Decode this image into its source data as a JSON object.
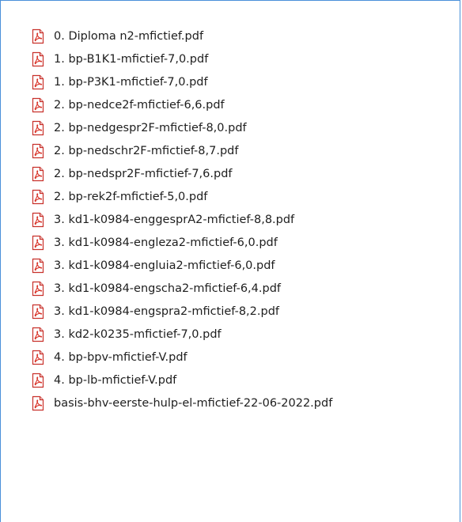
{
  "colors": {
    "border_accent": "#4a90d9",
    "pdf_icon_red": "#d93025",
    "text": "#1e1e1e"
  },
  "file_icon": "pdf-file-icon",
  "files": [
    {
      "name": "0. Diploma n2-mfictief.pdf"
    },
    {
      "name": "1. bp-B1K1-mfictief-7,0.pdf"
    },
    {
      "name": "1. bp-P3K1-mfictief-7,0.pdf"
    },
    {
      "name": "2. bp-nedce2f-mfictief-6,6.pdf"
    },
    {
      "name": "2. bp-nedgespr2F-mfictief-8,0.pdf"
    },
    {
      "name": "2. bp-nedschr2F-mfictief-8,7.pdf"
    },
    {
      "name": "2. bp-nedspr2F-mfictief-7,6.pdf"
    },
    {
      "name": "2. bp-rek2f-mfictief-5,0.pdf"
    },
    {
      "name": "3. kd1-k0984-enggesprA2-mfictief-8,8.pdf"
    },
    {
      "name": "3. kd1-k0984-engleza2-mfictief-6,0.pdf"
    },
    {
      "name": "3. kd1-k0984-engluia2-mfictief-6,0.pdf"
    },
    {
      "name": "3. kd1-k0984-engscha2-mfictief-6,4.pdf"
    },
    {
      "name": "3. kd1-k0984-engspra2-mfictief-8,2.pdf"
    },
    {
      "name": "3. kd2-k0235-mfictief-7,0.pdf"
    },
    {
      "name": "4. bp-bpv-mfictief-V.pdf"
    },
    {
      "name": "4. bp-lb-mfictief-V.pdf"
    },
    {
      "name": "basis-bhv-eerste-hulp-el-mfictief-22-06-2022.pdf"
    }
  ]
}
